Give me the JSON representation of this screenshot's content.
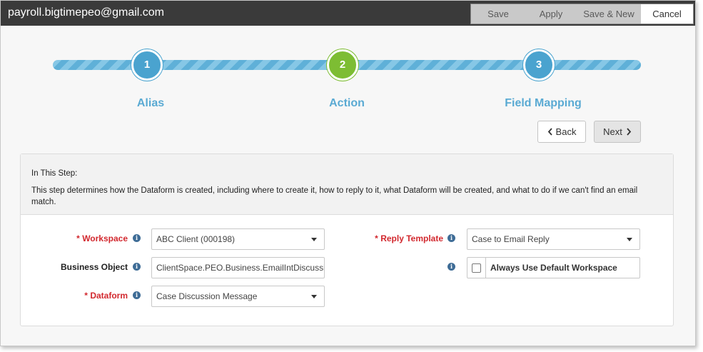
{
  "window": {
    "title": "payroll.bigtimepeo@gmail.com"
  },
  "toolbar": {
    "save": "Save",
    "apply": "Apply",
    "save_new": "Save & New",
    "cancel": "Cancel"
  },
  "steps": [
    {
      "number": "1",
      "label": "Alias",
      "state": "complete"
    },
    {
      "number": "2",
      "label": "Action",
      "state": "current"
    },
    {
      "number": "3",
      "label": "Field Mapping",
      "state": "upcoming"
    }
  ],
  "nav": {
    "back": "Back",
    "next": "Next"
  },
  "info_panel": {
    "title": "In This Step:",
    "description": "This step determines how the Dataform is created, including where to create it, how to reply to it, what Dataform will be created, and what to do if we can't find an email match."
  },
  "form": {
    "workspace": {
      "required_mark": "*",
      "label": "Workspace",
      "value": "ABC Client (000198)"
    },
    "business_object": {
      "label": "Business Object",
      "value": "ClientSpace.PEO.Business.EmailIntDiscussion"
    },
    "dataform": {
      "required_mark": "*",
      "label": "Dataform",
      "value": "Case Discussion Message"
    },
    "reply_template": {
      "required_mark": "*",
      "label": "Reply Template",
      "value": "Case to Email Reply"
    },
    "always_default": {
      "label": "Always Use Default Workspace",
      "checked": false
    }
  },
  "icons": {
    "info": "info-icon",
    "back": "chevron-left-icon",
    "next": "chevron-right-icon",
    "dropdown": "caret-down-icon"
  },
  "colors": {
    "titlebar": "#3a3a3a",
    "step_blue": "#4aa3cf",
    "step_green": "#7dbd33",
    "required": "#d2282e",
    "info_icon": "#3e6c96"
  }
}
